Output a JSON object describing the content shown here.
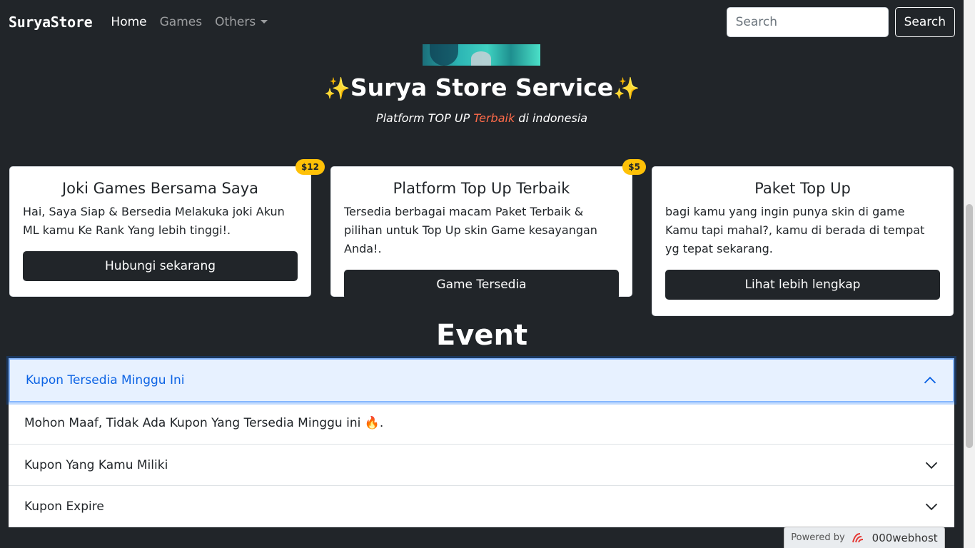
{
  "navbar": {
    "brand": "SuryaStore",
    "links": [
      {
        "label": "Home",
        "active": true
      },
      {
        "label": "Games",
        "active": false
      },
      {
        "label": "Others",
        "active": false
      }
    ],
    "search_placeholder": "Search",
    "search_button": "Search"
  },
  "hero": {
    "sparkle_left": "✨",
    "title": "Surya Store Service",
    "sparkle_right": "✨",
    "subtitle_prefix": "Platform TOP UP ",
    "subtitle_highlight": "Terbaik",
    "subtitle_suffix": " di indonesia"
  },
  "cards": [
    {
      "title": "Joki Games Bersama Saya",
      "text": "Hai, Saya Siap & Bersedia Melakuka joki Akun ML kamu Ke Rank Yang lebih tinggi!.",
      "button": "Hubungi sekarang",
      "badge": "$12"
    },
    {
      "title": "Platform Top Up Terbaik",
      "text": "Tersedia berbagai macam Paket Terbaik & pilihan untuk Top Up skin Game kesayangan Anda!.",
      "button": "Game Tersedia",
      "badge": "$5"
    },
    {
      "title": "Paket Top Up",
      "text": "bagi kamu yang ingin punya skin di game Kamu tapi mahal?, kamu di berada di tempat yg tepat sekarang.",
      "button": "Lihat lebih lengkap"
    }
  ],
  "event": {
    "title": "Event",
    "accordion": [
      {
        "header": "Kupon Tersedia Minggu Ini",
        "expanded": true,
        "body": "Mohon Maaf, Tidak Ada Kupon Yang Tersedia Minggu ini 🔥."
      },
      {
        "header": "Kupon Yang Kamu Miliki",
        "expanded": false
      },
      {
        "header": "Kupon Expire",
        "expanded": false
      }
    ]
  },
  "footer_badge": {
    "prefix": "Powered by",
    "brand": "000webhost"
  },
  "colors": {
    "background": "#212529",
    "accent_badge": "#ffc107",
    "highlight": "#ff6b4a",
    "accordion_active": "#0c63e4"
  }
}
